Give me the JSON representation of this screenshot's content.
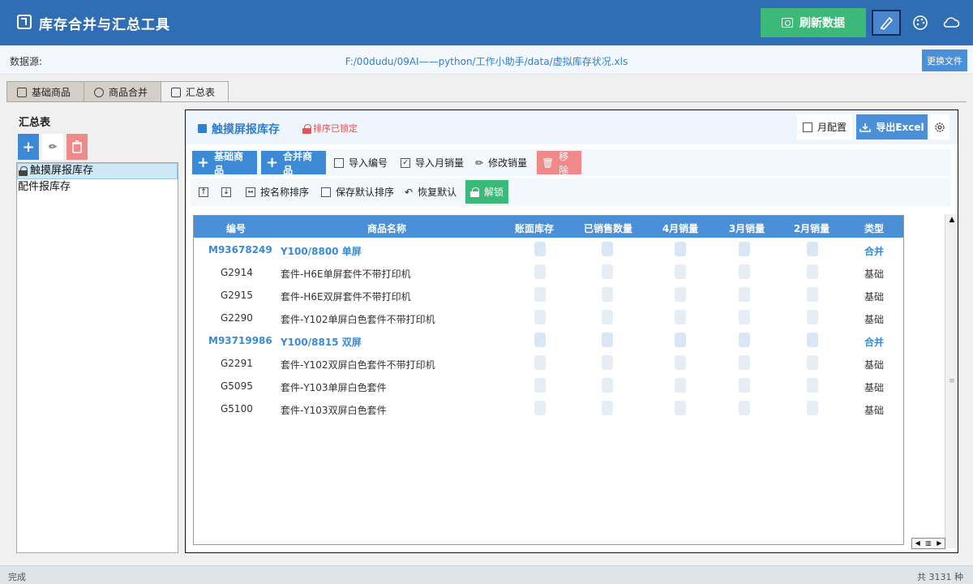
{
  "app": {
    "title": "库存合并与汇总工具",
    "refresh_label": "刷新数据"
  },
  "source": {
    "label": "数据源:",
    "path": "F:/00dudu/09AI——python/工作小助手/data/虚拟库存状况.xls",
    "change_label": "更换文件"
  },
  "tabs": [
    {
      "label": "基础商品"
    },
    {
      "label": "商品合并"
    },
    {
      "label": "汇总表"
    }
  ],
  "left": {
    "title": "汇总表",
    "items": [
      {
        "label": "触摸屏报库存",
        "locked": true,
        "selected": true
      },
      {
        "label": "配件报库存",
        "locked": false,
        "selected": false
      }
    ]
  },
  "panel": {
    "title": "触摸屏报库存",
    "lock_status": "排序已锁定",
    "month_config_label": "月配置",
    "export_label": "导出Excel",
    "toolbar1": {
      "base_goods": "基础商品",
      "merge_goods": "合并商品",
      "import_code": "导入编号",
      "import_sales": "导入月销量",
      "edit_sales": "修改销量",
      "remove": "移除"
    },
    "toolbar2": {
      "sort_by_name": "按名称排序",
      "save_default_sort": "保存默认排序",
      "restore_default": "恢复默认",
      "unlock": "解锁"
    }
  },
  "table": {
    "columns": [
      "编号",
      "商品名称",
      "账面库存",
      "已销售数量",
      "4月销量",
      "3月销量",
      "2月销量",
      "类型"
    ],
    "rows": [
      {
        "code": "M93678249",
        "name": "Y100/8800 单屏",
        "type": "合并",
        "merge": true
      },
      {
        "code": "G2914",
        "name": "套件-H6E单屏套件不带打印机",
        "type": "基础",
        "merge": false
      },
      {
        "code": "G2915",
        "name": "套件-H6E双屏套件不带打印机",
        "type": "基础",
        "merge": false
      },
      {
        "code": "G2290",
        "name": "套件-Y102单屏白色套件不带打印机",
        "type": "基础",
        "merge": false
      },
      {
        "code": "M93719986",
        "name": "Y100/8815 双屏",
        "type": "合并",
        "merge": true
      },
      {
        "code": "G2291",
        "name": "套件-Y102双屏白色套件不带打印机",
        "type": "基础",
        "merge": false
      },
      {
        "code": "G5095",
        "name": "套件-Y103单屏白色套件",
        "type": "基础",
        "merge": false
      },
      {
        "code": "G5100",
        "name": "套件-Y103双屏白色套件",
        "type": "基础",
        "merge": false
      }
    ]
  },
  "status": {
    "left": "完成",
    "right": "共 3131 种"
  },
  "colors": {
    "header": "#2f6db5",
    "accent": "#4a90d9",
    "green": "#3cb878",
    "red": "#f08a8a"
  }
}
